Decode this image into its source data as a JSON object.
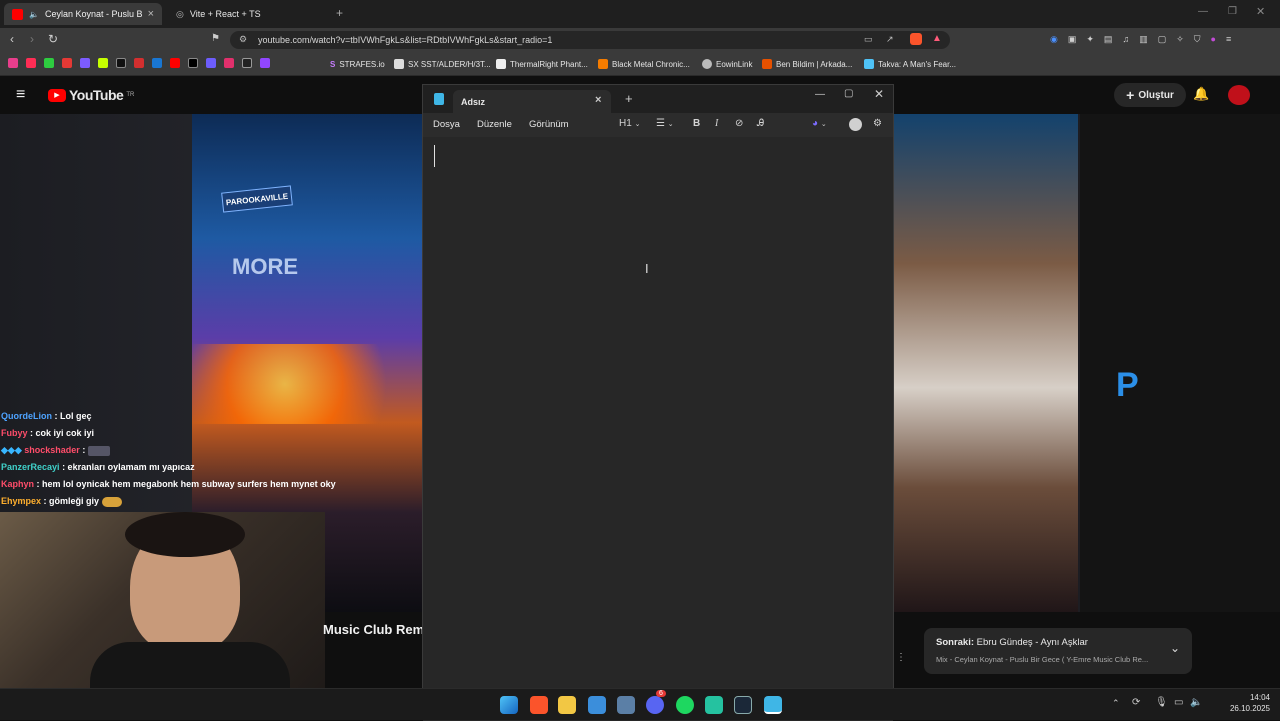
{
  "browser": {
    "tabs": [
      {
        "title": "Ceylan Koynat - Puslu Bir Ge...",
        "active": true
      },
      {
        "title": "Vite + React + TS",
        "active": false
      }
    ],
    "new_tab": "+",
    "url": "youtube.com/watch?v=tbIVWhFgkLs&list=RDtbIVWhFgkLs&start_radio=1",
    "bookmarks": [
      "STRAFES.io",
      "SX SST/ALDER/H/3T...",
      "ThermalRight Phant...",
      "Black Metal Chronic...",
      "EowinLink",
      "Ben Bildim | Arkada...",
      "Takva: A Man's Fear..."
    ],
    "accent": "#f00"
  },
  "youtube": {
    "logo": "YouTube",
    "logo_sup": "TR",
    "create_label": "Oluştur",
    "video_title": "Music Club Remi",
    "up_next_label": "Sonraki:",
    "up_next_title": "Ebru Gündeş - Aynı Aşklar",
    "up_next_sub": "Mix - Ceylan Koynat - Puslu Bir Gece ( Y-Emre Music Club Re...",
    "stage_sign": "PAROOKAVILLE",
    "stage_text": "MORE",
    "brand_mark": "P"
  },
  "chat": [
    {
      "user": "QuordeLion",
      "msg": ": Lol geç",
      "color": "#4ea3ff"
    },
    {
      "user": "Fubyy",
      "msg": ": cok iyi cok iyi",
      "color": "#ff4d6a"
    },
    {
      "user": "shockshader",
      "msg": ":",
      "color": "#ff4d6a"
    },
    {
      "user": "PanzerRecayi",
      "msg": ": ekranları oylamam mı yapıcaz",
      "color": "#3fd0c9"
    },
    {
      "user": "Kaphyn",
      "msg": ": hem lol oynicak hem megabonk hem subway surfers hem mynet oky",
      "color": "#ff4d6a"
    },
    {
      "user": "Ehympex",
      "msg": ": gömleği giy",
      "color": "#ffb02e"
    }
  ],
  "notepad": {
    "tab_title": "Adsız",
    "menu": [
      "Dosya",
      "Düzenle",
      "Görünüm"
    ],
    "heading_select": "H1",
    "content": ""
  },
  "taskbar": {
    "time": "14:04",
    "date": "26.10.2025",
    "discord_badge": "6"
  }
}
